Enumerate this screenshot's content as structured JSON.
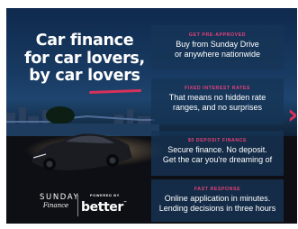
{
  "headline": {
    "line1": "Car finance",
    "line2": "for car lovers,",
    "line3": "by car lovers"
  },
  "features": [
    {
      "title": "GET PRE-APPROVED",
      "line1": "Buy from Sunday Drive",
      "line2": "or anywhere nationwide"
    },
    {
      "title": "FIXED INTEREST RATES",
      "line1": "That means no hidden rate",
      "line2": "ranges, and no surprises"
    },
    {
      "title": "$0 DEPOSIT FINANCE",
      "line1": "Secure finance. No deposit.",
      "line2": "Get the car you're dreaming of"
    },
    {
      "title": "FAST RESPONSE",
      "line1": "Online application in minutes.",
      "line2": "Lending decisions in three hours"
    }
  ],
  "logos": {
    "sunday_main": "SUNDAY",
    "sunday_sub": "Finance",
    "powered_by": "POWERED BY",
    "better": "better"
  },
  "colors": {
    "accent": "#e8407a",
    "background": "#16324f",
    "panel": "#163456"
  },
  "icons": {
    "arrow": "chevron-right-icon"
  }
}
